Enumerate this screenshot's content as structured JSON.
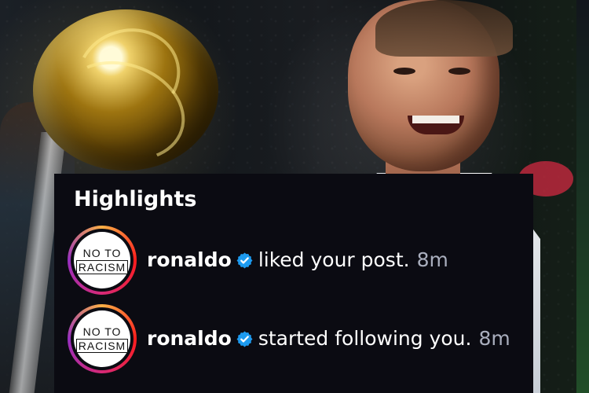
{
  "highlights": {
    "title": "Highlights",
    "notifications": [
      {
        "logo_line_1": "NO TO",
        "logo_line_2": "RACISM",
        "username": "ronaldo",
        "action": "liked your post.",
        "time": "8m",
        "verified_icon": "verified-badge-icon"
      },
      {
        "logo_line_1": "NO TO",
        "logo_line_2": "RACISM",
        "username": "ronaldo",
        "action": "started following you.",
        "time": "8m",
        "verified_icon": "verified-badge-icon"
      }
    ]
  },
  "colors": {
    "panel_background": "#0b0b12",
    "verified_blue": "#1d9bf0",
    "secondary_text": "#a9aebd",
    "story_ring_start": "#fcb045",
    "story_ring_end": "#962fbf"
  }
}
